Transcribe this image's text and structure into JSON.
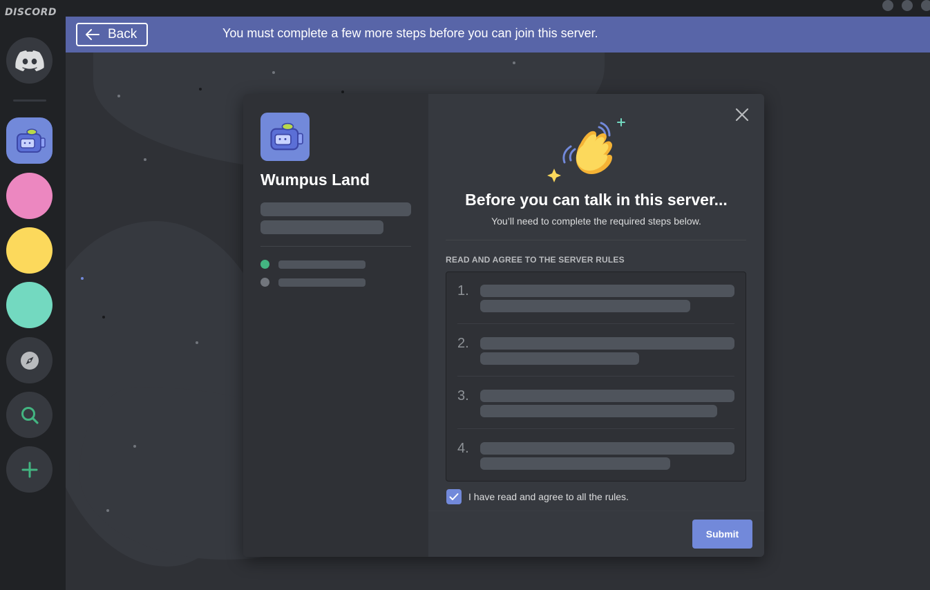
{
  "app": {
    "wordmark": "DISCORD"
  },
  "rail": {
    "items": [
      {
        "name": "discord-home",
        "icon": "discord-logo-icon",
        "color": "#36393f"
      },
      {
        "name": "wumpus-land",
        "icon": "wumpus-robot-icon",
        "color": "#7289da",
        "selected": true
      },
      {
        "name": "server-pink",
        "color": "#ec87c0"
      },
      {
        "name": "server-yellow",
        "color": "#fcd95c"
      },
      {
        "name": "server-teal",
        "color": "#73d9c0"
      },
      {
        "name": "explore",
        "icon": "compass-icon"
      },
      {
        "name": "search",
        "icon": "search-icon"
      },
      {
        "name": "add-server",
        "icon": "plus-icon"
      }
    ]
  },
  "banner": {
    "back_label": "Back",
    "message": "You must complete a few more steps before you can join this server.",
    "color": "#5865a8"
  },
  "modal": {
    "server_name": "Wumpus Land",
    "status_dots": [
      "#43b581",
      "#72767d"
    ],
    "title": "Before you can talk in this server...",
    "subtitle": "You’ll need to complete the required steps below.",
    "section_label": "READ AND AGREE TO THE SERVER RULES",
    "rules": [
      {
        "number": "1."
      },
      {
        "number": "2."
      },
      {
        "number": "3."
      },
      {
        "number": "4."
      }
    ],
    "agree_label": "I have read and agree to all the rules.",
    "agree_checked": true,
    "submit_label": "Submit",
    "accent": "#7289da"
  }
}
